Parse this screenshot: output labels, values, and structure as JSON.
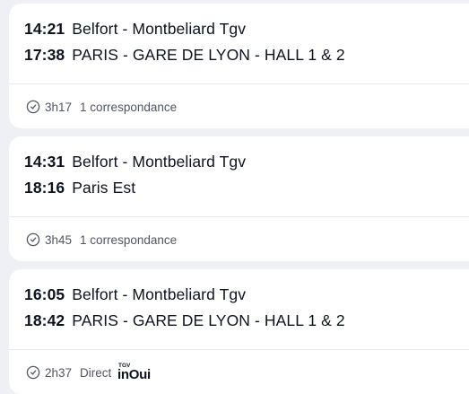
{
  "journeys": [
    {
      "departure_time": "14:21",
      "departure_station": "Belfort - Montbeliard Tgv",
      "arrival_time": "17:38",
      "arrival_station": "PARIS - GARE DE LYON - HALL 1 & 2",
      "duration": "3h17",
      "connections": "1 correspondance"
    },
    {
      "departure_time": "14:31",
      "departure_station": "Belfort - Montbeliard Tgv",
      "arrival_time": "18:16",
      "arrival_station": "Paris Est",
      "duration": "3h45",
      "connections": "1 correspondance"
    },
    {
      "departure_time": "16:05",
      "departure_station": "Belfort - Montbeliard Tgv",
      "arrival_time": "18:42",
      "arrival_station": "PARIS - GARE DE LYON - HALL 1 & 2",
      "duration": "2h37",
      "connections": "Direct",
      "brand_top": "TGV",
      "brand_main": "inOui"
    }
  ],
  "icons": {
    "duration": "clock-icon",
    "brand": "tgv-inoui-logo"
  },
  "colors": {
    "background": "#eef0f6",
    "card": "#ffffff",
    "text": "#0c131f",
    "muted": "#4f5563",
    "divider": "#e7e9ef"
  }
}
